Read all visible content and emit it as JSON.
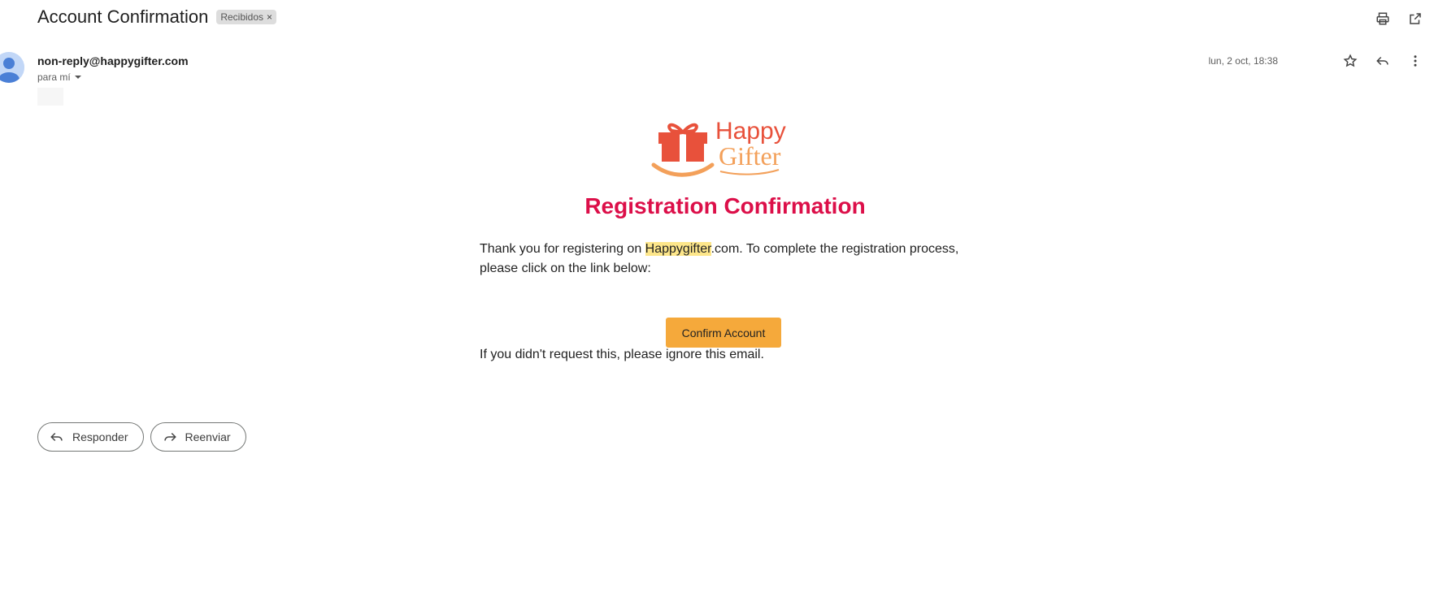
{
  "email": {
    "subject": "Account Confirmation",
    "label_chip": "Recibidos",
    "chip_remove": "×",
    "sender": "non-reply@happygifter.com",
    "recipient": "para mí",
    "date": "lun, 2 oct, 18:38"
  },
  "icons": {
    "print": "print-icon",
    "open_new_window": "open-in-new-window-icon",
    "star": "star-icon",
    "reply": "reply-icon",
    "more": "more-vert-icon",
    "forward": "forward-icon"
  },
  "body": {
    "logo_line1": "Happy",
    "logo_line2": "Gifter",
    "headline": "Registration Confirmation",
    "para_before": "Thank you for registering on ",
    "para_highlight": "Happygifter",
    "para_after": ".com. To complete the registration process, please click on the link below:",
    "cta": "Confirm Account",
    "ignore_text": "If you didn't request this, please ignore this email."
  },
  "footer": {
    "reply_label": "Responder",
    "forward_label": "Reenviar"
  },
  "colors": {
    "headline": "#dc0f49",
    "cta_bg": "#f5a93b",
    "logo_red": "#e8513b",
    "logo_orange": "#f3a05a",
    "highlight": "#fde68a"
  }
}
